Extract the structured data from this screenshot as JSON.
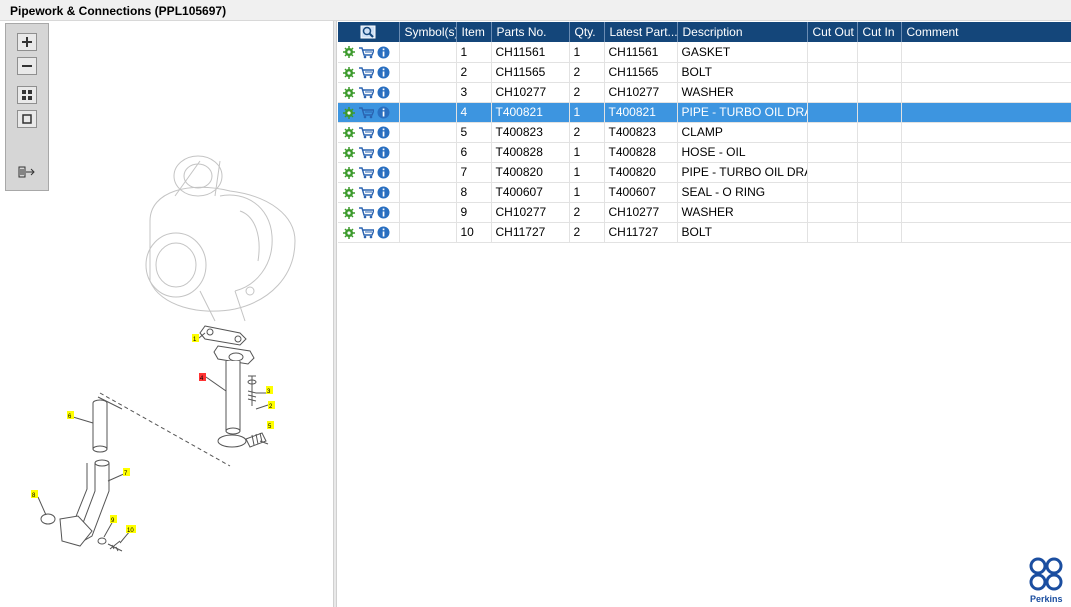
{
  "window": {
    "title": "Pipework & Connections (PPL105697)"
  },
  "table": {
    "columns": [
      "Symbol(s)",
      "Item",
      "Parts No.",
      "Qty.",
      "Latest Part...",
      "Description",
      "Cut Out",
      "Cut In",
      "Comment"
    ],
    "selected_index": 3,
    "rows": [
      {
        "item": "1",
        "parts_no": "CH11561",
        "qty": "1",
        "latest_part": "CH11561",
        "description": "GASKET",
        "cut_out": "",
        "cut_in": "",
        "comment": ""
      },
      {
        "item": "2",
        "parts_no": "CH11565",
        "qty": "2",
        "latest_part": "CH11565",
        "description": "BOLT",
        "cut_out": "",
        "cut_in": "",
        "comment": ""
      },
      {
        "item": "3",
        "parts_no": "CH10277",
        "qty": "2",
        "latest_part": "CH10277",
        "description": "WASHER",
        "cut_out": "",
        "cut_in": "",
        "comment": ""
      },
      {
        "item": "4",
        "parts_no": "T400821",
        "qty": "1",
        "latest_part": "T400821",
        "description": "PIPE - TURBO OIL DRAIN",
        "cut_out": "",
        "cut_in": "",
        "comment": ""
      },
      {
        "item": "5",
        "parts_no": "T400823",
        "qty": "2",
        "latest_part": "T400823",
        "description": "CLAMP",
        "cut_out": "",
        "cut_in": "",
        "comment": ""
      },
      {
        "item": "6",
        "parts_no": "T400828",
        "qty": "1",
        "latest_part": "T400828",
        "description": "HOSE - OIL",
        "cut_out": "",
        "cut_in": "",
        "comment": ""
      },
      {
        "item": "7",
        "parts_no": "T400820",
        "qty": "1",
        "latest_part": "T400820",
        "description": "PIPE - TURBO OIL DRAIN",
        "cut_out": "",
        "cut_in": "",
        "comment": ""
      },
      {
        "item": "8",
        "parts_no": "T400607",
        "qty": "1",
        "latest_part": "T400607",
        "description": "SEAL - O RING",
        "cut_out": "",
        "cut_in": "",
        "comment": ""
      },
      {
        "item": "9",
        "parts_no": "CH10277",
        "qty": "2",
        "latest_part": "CH10277",
        "description": "WASHER",
        "cut_out": "",
        "cut_in": "",
        "comment": ""
      },
      {
        "item": "10",
        "parts_no": "CH11727",
        "qty": "2",
        "latest_part": "CH11727",
        "description": "BOLT",
        "cut_out": "",
        "cut_in": "",
        "comment": ""
      }
    ]
  },
  "diagram": {
    "callouts": [
      "1",
      "2",
      "3",
      "4",
      "5",
      "6",
      "7",
      "8",
      "9",
      "10"
    ],
    "highlighted_callout": "4"
  },
  "toolbar": {
    "buttons": [
      "zoom-in-icon",
      "zoom-out-icon",
      "fit-to-window-icon",
      "actual-size-icon",
      "export-icon"
    ]
  },
  "row_icons": [
    "gear-icon",
    "cart-icon",
    "info-icon"
  ],
  "brand": {
    "logo_text": "Perkins",
    "color": "#1b4ea0"
  },
  "colors": {
    "header_bg": "#14467a",
    "selected_row": "#3d95e0",
    "callout_yellow": "#ffff00",
    "callout_red": "#ff3333"
  }
}
